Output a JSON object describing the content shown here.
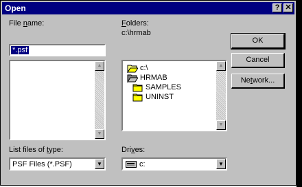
{
  "window": {
    "title": "Open",
    "help_button": "?",
    "close_button": "✕"
  },
  "file_name": {
    "label_pre": "File ",
    "label_accel": "n",
    "label_post": "ame:",
    "value": "*.psf"
  },
  "folders": {
    "label_accel": "F",
    "label_post": "olders:",
    "path": "c:\\hrmab",
    "tree": [
      {
        "name": "c:\\",
        "icon": "open-folder-icon"
      },
      {
        "name": "HRMAB",
        "icon": "open-folder-icon"
      },
      {
        "name": "SAMPLES",
        "icon": "folder-icon"
      },
      {
        "name": "UNINST",
        "icon": "folder-icon"
      }
    ]
  },
  "buttons": {
    "ok": "OK",
    "cancel": "Cancel",
    "network_pre": "Ne",
    "network_accel": "t",
    "network_post": "work..."
  },
  "file_type": {
    "label_pre": "List files of ",
    "label_accel": "t",
    "label_post": "ype:",
    "value": "PSF Files (*.PSF)"
  },
  "drives": {
    "label_pre": "Dri",
    "label_accel": "v",
    "label_post": "es:",
    "value": "c:",
    "icon": "drive-icon"
  },
  "scroll_arrows": {
    "up": "▲",
    "down": "▼"
  }
}
